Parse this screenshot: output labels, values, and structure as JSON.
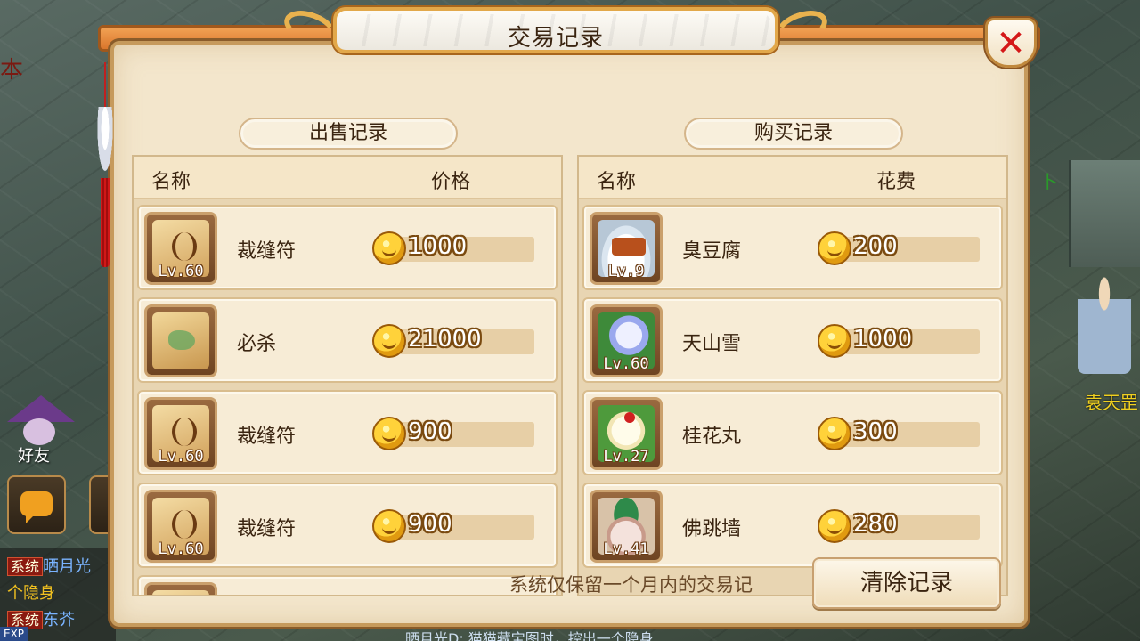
{
  "background": {
    "left_edge_text": "本",
    "right_edge_text": "卜",
    "npc_name": "袁天罡",
    "friend_label": "好友",
    "chat_lines": [
      {
        "tag": "系统",
        "text": "晒月光"
      },
      {
        "tag": "",
        "text": "个隐身"
      },
      {
        "tag": "系统",
        "text": "东芥"
      }
    ],
    "bottom_text": "晒月光D: 猫猫藏宝图时，控出一个隐身",
    "exp_label": "EXP"
  },
  "dialog": {
    "title": "交易记录",
    "close_label": "✕",
    "sell": {
      "header": "出售记录",
      "col_name": "名称",
      "col_price": "价格",
      "items": [
        {
          "name": "裁缝符",
          "level": "Lv.60",
          "price": "1000",
          "icon": "scroll-icon"
        },
        {
          "name": "必杀",
          "level": "",
          "price": "21000",
          "icon": "map-scroll-icon"
        },
        {
          "name": "裁缝符",
          "level": "Lv.60",
          "price": "900",
          "icon": "scroll-icon"
        },
        {
          "name": "裁缝符",
          "level": "Lv.60",
          "price": "900",
          "icon": "scroll-icon"
        }
      ]
    },
    "buy": {
      "header": "购买记录",
      "col_name": "名称",
      "col_price": "花费",
      "items": [
        {
          "name": "臭豆腐",
          "level": "Lv.9",
          "price": "200",
          "icon": "tofu-icon"
        },
        {
          "name": "天山雪",
          "level": "Lv.60",
          "price": "1000",
          "icon": "lotus-icon"
        },
        {
          "name": "桂花丸",
          "level": "Lv.27",
          "price": "300",
          "icon": "osmanthus-ball-icon"
        },
        {
          "name": "佛跳墙",
          "level": "Lv.41",
          "price": "280",
          "icon": "jar-icon"
        }
      ]
    },
    "footer_note": "系统仅保留一个月内的交易记",
    "clear_button": "清除记录"
  }
}
